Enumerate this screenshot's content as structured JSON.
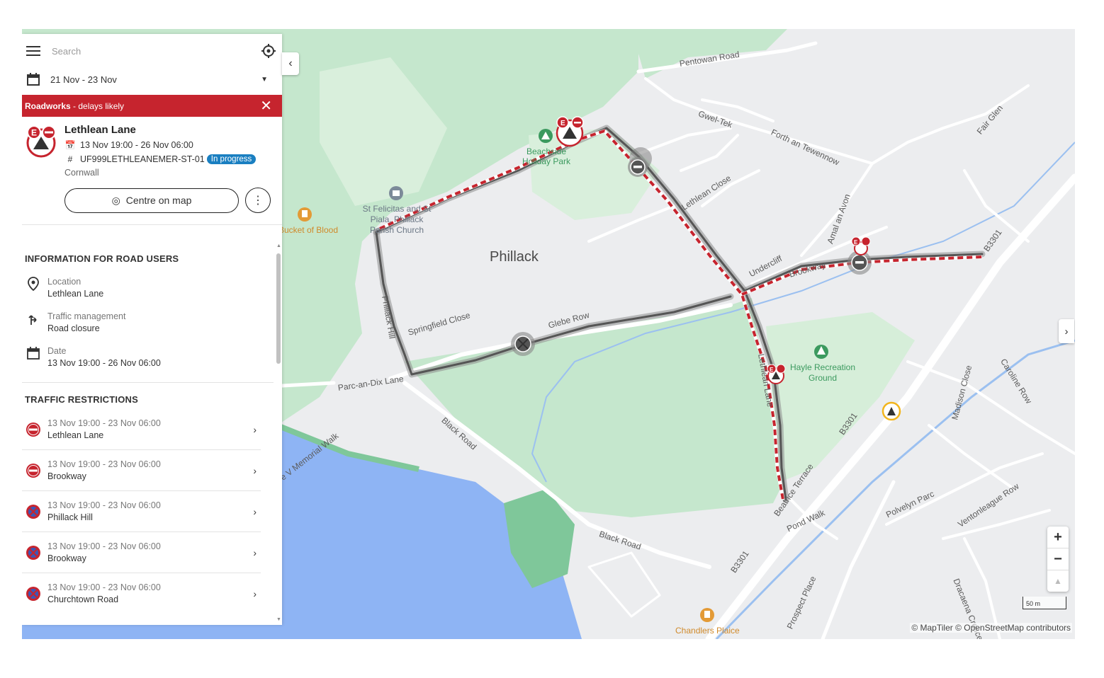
{
  "search": {
    "placeholder": "Search"
  },
  "date_filter": {
    "value": "21 Nov - 23 Nov"
  },
  "alert": {
    "strong": "Roadworks",
    "rest": " - delays likely"
  },
  "detail": {
    "title": "Lethlean Lane",
    "dates": "13 Nov 19:00 - 26 Nov 06:00",
    "reference": "UF999LETHLEANEMER-ST-01",
    "status": "In progress",
    "area": "Cornwall",
    "centre_label": "Centre on map"
  },
  "info_section": {
    "title": "INFORMATION FOR ROAD USERS",
    "items": [
      {
        "label": "Location",
        "value": "Lethlean Lane",
        "icon": "location-pin-icon"
      },
      {
        "label": "Traffic management",
        "value": "Road closure",
        "icon": "traffic-arrows-icon"
      },
      {
        "label": "Date",
        "value": "13 Nov 19:00 - 26 Nov 06:00",
        "icon": "calendar-icon"
      }
    ]
  },
  "restrictions_section": {
    "title": "TRAFFIC RESTRICTIONS",
    "items": [
      {
        "dates": "13 Nov 19:00 - 23 Nov 06:00",
        "road": "Lethlean Lane",
        "icon": "no-entry-icon"
      },
      {
        "dates": "13 Nov 19:00 - 23 Nov 06:00",
        "road": "Brookway",
        "icon": "no-entry-icon"
      },
      {
        "dates": "13 Nov 19:00 - 23 Nov 06:00",
        "road": "Phillack Hill",
        "icon": "no-stopping-icon"
      },
      {
        "dates": "13 Nov 19:00 - 23 Nov 06:00",
        "road": "Brookway",
        "icon": "no-stopping-icon"
      },
      {
        "dates": "13 Nov 19:00 - 23 Nov 06:00",
        "road": "Churchtown Road",
        "icon": "no-stopping-icon"
      }
    ]
  },
  "map": {
    "place": "Phillack",
    "roads": {
      "pentowan": "Pentowan Road",
      "gwel_tek": "Gwel-Tek",
      "forth": "Forth an Tewennow",
      "fair_glen": "Fair Glen",
      "lethlean_close": "Lethlean Close",
      "amal_an_avon": "Amal an Avon",
      "undercliff": "Undercliff",
      "brookway": "Brookway",
      "b3301_a": "B3301",
      "b3301_b": "B3301",
      "b3301_c": "B3301",
      "phillack_hill": "Phillack Hill",
      "springfield": "Springfield Close",
      "glebe_row": "Glebe Row",
      "parc_an_dix": "Parc-an-Dix Lane",
      "black_road_1": "Black Road",
      "black_road_2": "Black Road",
      "memorial_walk": "e V Memorial Walk",
      "lethlean_lane": "Lethlean Lane",
      "beatrice": "Beatrice Terrace",
      "pond_walk": "Pond Walk",
      "madison": "Madison Close",
      "caroline": "Caroline Row",
      "polvelyn": "Polvelyn Parc",
      "ventonleague": "Ventonleague Row",
      "dracaena": "Dracaena Crescent",
      "prospect": "Prospect Place"
    },
    "pois": {
      "beachside": "Beachside Holiday Park",
      "church": "St Felicitas and St Piala, Phillack Parish Church",
      "bucket": "Bucket of Blood",
      "hayle": "Hayle Recreation Ground",
      "chandlers": "Chandlers Plaice"
    },
    "scale": "50 m",
    "attribution": "© MapTiler © OpenStreetMap contributors",
    "zoom_in": "+",
    "zoom_out": "−",
    "compass": "▲"
  },
  "colors": {
    "accent_red": "#c6242e",
    "badge_blue": "#1a7fc1",
    "park_green": "#c2e6cb",
    "water_blue": "#8db4f5"
  }
}
